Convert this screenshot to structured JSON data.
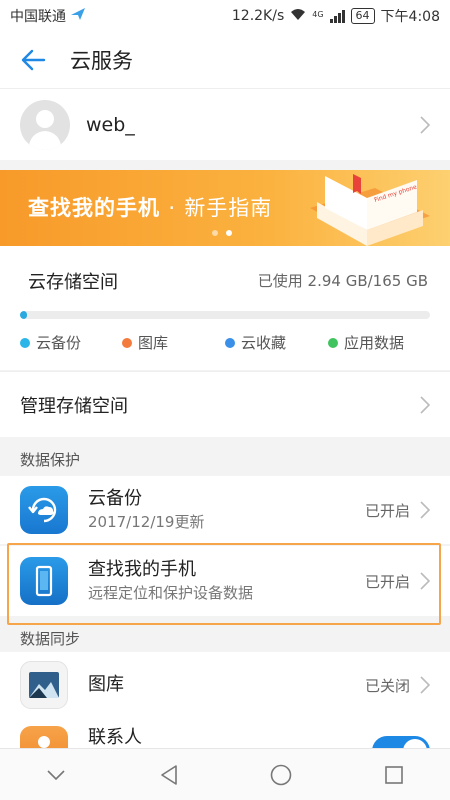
{
  "status_bar": {
    "carrier": "中国联通",
    "speed": "12.2K/s",
    "network": "4G",
    "battery": "64",
    "time": "下午4:08"
  },
  "header": {
    "title": "云服务"
  },
  "account": {
    "name": "web_"
  },
  "banner": {
    "title": "查找我的手机",
    "separator": "·",
    "subtitle": "新手指南",
    "book_text": "Find my phone",
    "page_count": 2,
    "active_page": 2
  },
  "storage": {
    "title": "云存储空间",
    "used_text": "已使用 2.94 GB/165 GB",
    "used_fraction": 0.018,
    "legend": [
      {
        "label": "云备份",
        "color": "#2cb5e8"
      },
      {
        "label": "图库",
        "color": "#f47b3e"
      },
      {
        "label": "云收藏",
        "color": "#3a8fe8"
      },
      {
        "label": "应用数据",
        "color": "#3fc35f"
      }
    ]
  },
  "manage": {
    "label": "管理存储空间"
  },
  "sections": {
    "data_protection": "数据保护",
    "data_sync": "数据同步"
  },
  "protection_items": [
    {
      "title": "云备份",
      "subtitle": "2017/12/19更新",
      "status": "已开启"
    },
    {
      "title": "查找我的手机",
      "subtitle": "远程定位和保护设备数据",
      "status": "已开启"
    }
  ],
  "sync_items": [
    {
      "title": "图库",
      "status": "已关闭"
    },
    {
      "title": "联系人"
    }
  ],
  "colors": {
    "accent": "#1e88e5",
    "banner_orange": "#f79a2a",
    "highlight": "#f7a54b"
  }
}
